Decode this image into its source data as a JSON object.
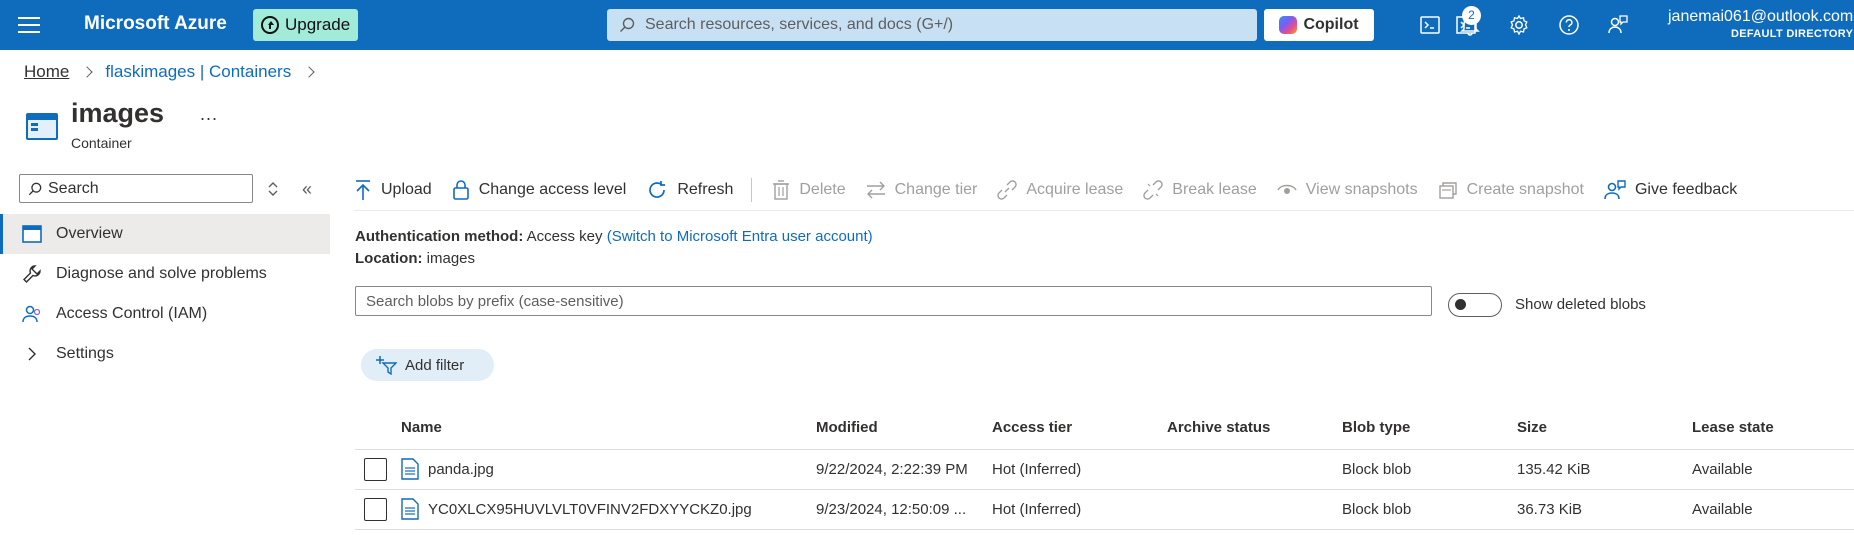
{
  "topbar": {
    "brand": "Microsoft Azure",
    "upgrade_label": "Upgrade",
    "search_placeholder": "Search resources, services, and docs (G+/)",
    "copilot_label": "Copilot",
    "notification_count": "2",
    "user_email": "janemai061@outlook.com",
    "user_directory": "DEFAULT DIRECTORY",
    "bar_color": "#0f6cbd"
  },
  "breadcrumb": {
    "home": "Home",
    "parent": "flaskimages | Containers"
  },
  "page": {
    "title": "images",
    "subtitle": "Container",
    "more": "..."
  },
  "nav": {
    "search_placeholder": "Search",
    "items": [
      {
        "label": "Overview",
        "icon": "overview-icon",
        "active": true
      },
      {
        "label": "Diagnose and solve problems",
        "icon": "wrench-icon"
      },
      {
        "label": "Access Control (IAM)",
        "icon": "people-icon"
      },
      {
        "label": "Settings",
        "icon": "chevron-right-icon"
      }
    ]
  },
  "toolbar": {
    "upload": "Upload",
    "change_access_level": "Change access level",
    "refresh": "Refresh",
    "delete": "Delete",
    "change_tier": "Change tier",
    "acquire_lease": "Acquire lease",
    "break_lease": "Break lease",
    "view_snapshots": "View snapshots",
    "create_snapshot": "Create snapshot",
    "give_feedback": "Give feedback"
  },
  "info": {
    "auth_label": "Authentication method:",
    "auth_value": "Access key",
    "auth_switch": "(Switch to Microsoft Entra user account)",
    "location_label": "Location:",
    "location_value": "images"
  },
  "blobs": {
    "search_placeholder": "Search blobs by prefix (case-sensitive)",
    "show_deleted_label": "Show deleted blobs",
    "add_filter": "Add filter",
    "columns": [
      "Name",
      "Modified",
      "Access tier",
      "Archive status",
      "Blob type",
      "Size",
      "Lease state"
    ],
    "rows": [
      {
        "name": "panda.jpg",
        "modified": "9/22/2024, 2:22:39 PM",
        "access_tier": "Hot (Inferred)",
        "archive_status": "",
        "blob_type": "Block blob",
        "size": "135.42 KiB",
        "lease_state": "Available"
      },
      {
        "name": "YC0XLCX95HUVLVLT0VFINV2FDXYYCKZ0.jpg",
        "modified": "9/23/2024, 12:50:09 ...",
        "access_tier": "Hot (Inferred)",
        "archive_status": "",
        "blob_type": "Block blob",
        "size": "36.73 KiB",
        "lease_state": "Available"
      }
    ]
  }
}
